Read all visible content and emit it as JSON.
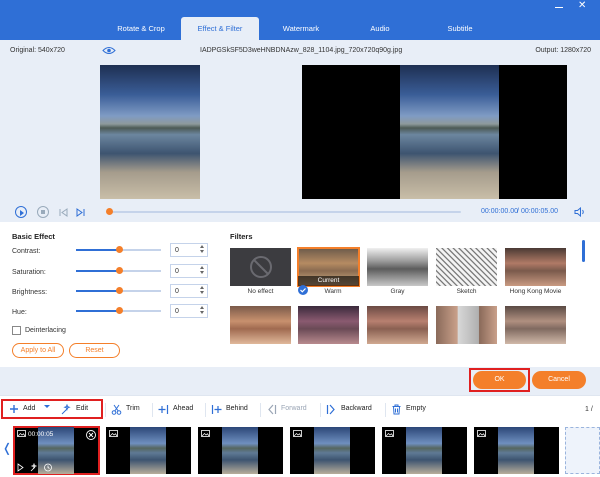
{
  "tabs": [
    {
      "label": "Rotate & Crop",
      "active": false
    },
    {
      "label": "Effect & Filter",
      "active": true
    },
    {
      "label": "Watermark",
      "active": false
    },
    {
      "label": "Audio",
      "active": false
    },
    {
      "label": "Subtitle",
      "active": false
    }
  ],
  "info": {
    "original": "Original: 540x720",
    "file_name": "IADPGSkSF5D3weHNBDNAzw_828_1104.jpg_720x720q90g.jpg",
    "output": "Output: 1280x720"
  },
  "playback": {
    "current_time": "00:00:00.00",
    "separator": "/",
    "total_time": "00:00:05.00",
    "progress": 0.0
  },
  "basic_effect": {
    "title": "Basic Effect",
    "controls": [
      {
        "label": "Contrast:",
        "value": "0"
      },
      {
        "label": "Saturation:",
        "value": "0"
      },
      {
        "label": "Brightness:",
        "value": "0"
      },
      {
        "label": "Hue:",
        "value": "0"
      }
    ],
    "deinterlacing": "Deinterlacing",
    "apply_all": "Apply to All",
    "reset": "Reset"
  },
  "filters": {
    "title": "Filters",
    "current_badge": "Current",
    "items": [
      {
        "name": "No effect"
      },
      {
        "name": "Warm",
        "selected": true
      },
      {
        "name": "Gray"
      },
      {
        "name": "Sketch"
      },
      {
        "name": "Hong Kong Movie"
      }
    ]
  },
  "dialog": {
    "ok": "OK",
    "cancel": "Cancel"
  },
  "toolbar": {
    "add": "Add",
    "edit": "Edit",
    "trim": "Trim",
    "ahead": "Ahead",
    "behind": "Behind",
    "forward": "Forward",
    "backward": "Backward",
    "empty": "Empty",
    "page": "1 / "
  },
  "clips": {
    "first_time": "00:00:05"
  },
  "colors": {
    "accent": "#2f6fd6",
    "orange": "#f47f2a",
    "highlight": "#e02020"
  }
}
